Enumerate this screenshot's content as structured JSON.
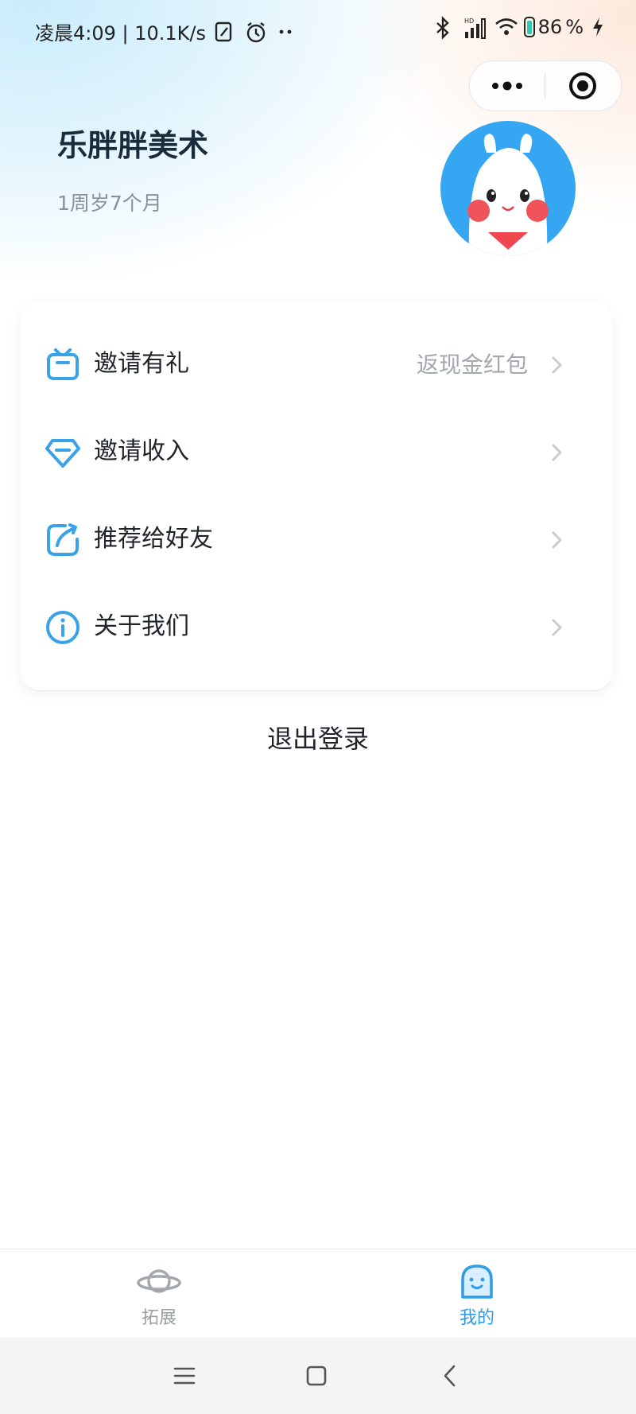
{
  "status_bar": {
    "time_text": "凌晨4:09 | 10.1K/s",
    "battery_level": "86",
    "battery_suffix": "%",
    "icons": [
      "edit-icon",
      "alarm-icon",
      "more-dots-icon",
      "bluetooth-icon",
      "signal-hd-icon",
      "wifi-icon",
      "battery-icon",
      "charging-icon"
    ]
  },
  "capsule": {
    "icons": [
      "more-icon",
      "close-target-icon"
    ]
  },
  "profile": {
    "name": "乐胖胖美术",
    "age": "1周岁7个月",
    "avatar_bg_color": "#35a6f1"
  },
  "menu": {
    "items": [
      {
        "label": "邀请有礼",
        "extra": "返现金红包",
        "icon": "gift-icon"
      },
      {
        "label": "邀请收入",
        "extra": "",
        "icon": "diamond-icon"
      },
      {
        "label": "推荐给好友",
        "extra": "",
        "icon": "share-icon"
      },
      {
        "label": "关于我们",
        "extra": "",
        "icon": "info-icon"
      }
    ],
    "icon_color": "#3aa3e8"
  },
  "logout_label": "退出登录",
  "tabbar": {
    "tabs": [
      {
        "label": "拓展",
        "icon": "planet-icon",
        "active": false
      },
      {
        "label": "我的",
        "icon": "ghost-icon",
        "active": true
      }
    ],
    "active_color": "#2e9be6",
    "inactive_color": "#9a9ea5"
  },
  "system_nav": {
    "buttons": [
      "menu-icon",
      "home-icon",
      "back-icon"
    ]
  }
}
